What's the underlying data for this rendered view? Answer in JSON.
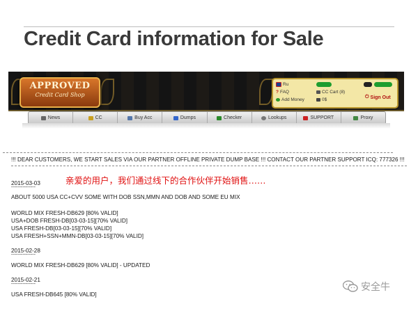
{
  "slide": {
    "title": "Credit Card information for Sale"
  },
  "banner": {
    "logo_line1": "APPROVED",
    "logo_line2": "Credit Card Shop"
  },
  "userbox": {
    "language": "Ru",
    "faq": "FAQ",
    "add_money": "Add Money",
    "cart": "CC Cart (8)",
    "support": "SUPPORT",
    "balance_count": "0$",
    "sign_out": "Sign Out"
  },
  "nav": {
    "items": [
      {
        "label": "News",
        "icon": "news-icon"
      },
      {
        "label": "CC",
        "icon": "card-icon"
      },
      {
        "label": "Buy Acc",
        "icon": "account-icon"
      },
      {
        "label": "Dumps",
        "icon": "dumps-icon"
      },
      {
        "label": "Checker",
        "icon": "checker-icon"
      },
      {
        "label": "Lookups",
        "icon": "lookup-icon"
      },
      {
        "label": "SUPPORT",
        "icon": "flag-icon"
      },
      {
        "label": "Proxy",
        "icon": "proxy-icon"
      }
    ]
  },
  "content": {
    "announcement": "!!! DEAR CUSTOMERS, WE START SALES VIA OUR PARTNER OFFLINE PRIVATE DUMP BASE !!! CONTACT OUR PARTNER SUPPORT ICQ: 777326 !!!",
    "annotation_cn": "亲爱的用户，我们通过线下的合作伙伴开始销售……",
    "date1": "2015-03-03",
    "sep": "---------------",
    "note1": "ABOUT 5000 USA CC+CVV SOME WITH DOB SSN,MMN AND DOB AND SOME EU MIX",
    "list1": [
      "WORLD MIX FRESH-DB629 [80% VALID]",
      "USA+DOB FRESH-DB[03-03-15][70% VALID]",
      "USA FRESH-DB[03-03-15][70% VALID]",
      "USA FRESH+SSN+MMN-DB[03-03-15][70% VALID]"
    ],
    "date2": "2015-02-28",
    "item2": "WORLD MIX FRESH-DB629 [80% VALID] - UPDATED",
    "date3": "2015-02-21",
    "item3": "USA FRESH-DB645 [80% VALID]"
  },
  "watermark": {
    "text": "安全牛"
  },
  "colors": {
    "title": "#3a3a3a",
    "annotation": "#e01010",
    "userbox_bg": "#f3e7a6",
    "banner_bg": "#141414"
  }
}
